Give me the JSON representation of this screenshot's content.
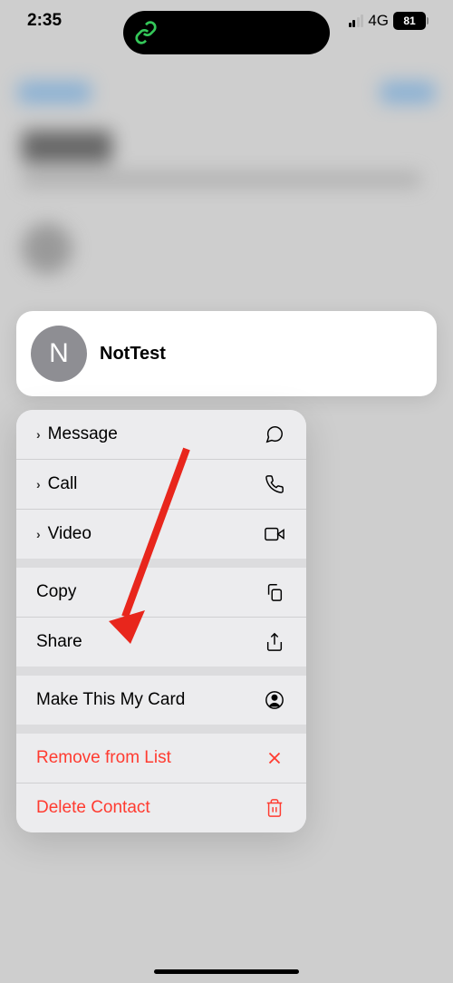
{
  "statusBar": {
    "time": "2:35",
    "network": "4G",
    "battery": "81"
  },
  "contact": {
    "initial": "N",
    "name": "NotTest"
  },
  "menu": {
    "group1": {
      "message": "Message",
      "call": "Call",
      "video": "Video"
    },
    "group2": {
      "copy": "Copy",
      "share": "Share"
    },
    "group3": {
      "makeMyCard": "Make This My Card"
    },
    "group4": {
      "removeFromList": "Remove from List",
      "deleteContact": "Delete Contact"
    }
  }
}
